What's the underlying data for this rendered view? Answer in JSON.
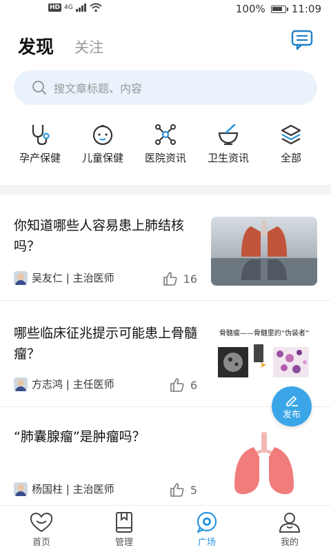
{
  "status_bar": {
    "battery": "100%",
    "time": "11:09",
    "hd": "HD",
    "network": "4G"
  },
  "header": {
    "tab_active": "发现",
    "tab_inactive": "关注"
  },
  "search": {
    "placeholder": "搜文章标题、内容"
  },
  "categories": [
    {
      "label": "孕产保健",
      "icon": "stethoscope-icon"
    },
    {
      "label": "儿童保健",
      "icon": "baby-icon"
    },
    {
      "label": "医院资讯",
      "icon": "network-icon"
    },
    {
      "label": "卫生资讯",
      "icon": "mortar-icon"
    },
    {
      "label": "全部",
      "icon": "layers-icon"
    }
  ],
  "articles": [
    {
      "title": "你知道哪些人容易患上肺结核吗？",
      "author": "吴友仁 | 主治医师",
      "likes": "16"
    },
    {
      "title": "哪些临床征兆提示可能患上骨髓瘤？",
      "author": "方志鸿 | 主任医师",
      "likes": "6",
      "thumb_title": "骨髓瘤——骨髓里的“伪装者”"
    },
    {
      "title": "“肺囊腺瘤”是肿瘤吗？",
      "author": "杨国柱 | 主治医师",
      "likes": "5"
    }
  ],
  "fab": {
    "label": "发布"
  },
  "bottom_nav": [
    {
      "label": "首页"
    },
    {
      "label": "管理"
    },
    {
      "label": "广场"
    },
    {
      "label": "我的"
    }
  ],
  "colors": {
    "accent": "#2a96e0",
    "fab": "#3aa6e8",
    "search_bg": "#eaf3fb"
  }
}
